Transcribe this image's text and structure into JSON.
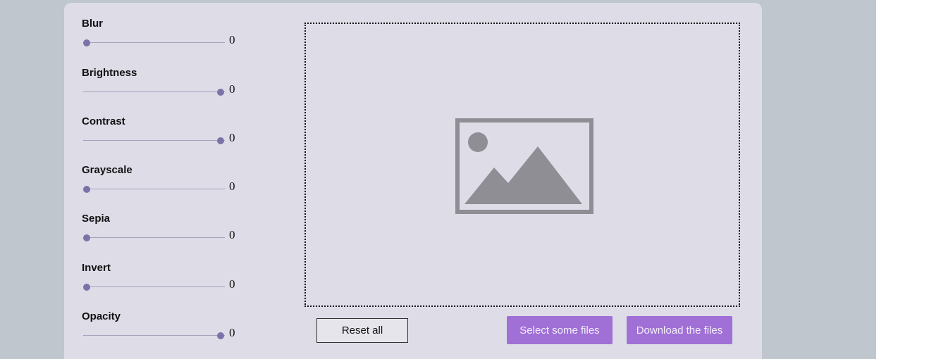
{
  "filters": [
    {
      "label": "Blur",
      "value": "0",
      "thumb": "min"
    },
    {
      "label": "Brightness",
      "value": "0",
      "thumb": "max"
    },
    {
      "label": "Contrast",
      "value": "0",
      "thumb": "max"
    },
    {
      "label": "Grayscale",
      "value": "0",
      "thumb": "min"
    },
    {
      "label": "Sepia",
      "value": "0",
      "thumb": "min"
    },
    {
      "label": "Invert",
      "value": "0",
      "thumb": "min"
    },
    {
      "label": "Opacity",
      "value": "0",
      "thumb": "max"
    }
  ],
  "preview": {
    "icon": "image-placeholder-icon"
  },
  "buttons": {
    "reset": "Reset all",
    "select": "Select some files",
    "download": "Download the files"
  },
  "colors": {
    "accent": "#a070d6",
    "slider_thumb": "#7c72a8",
    "panel": "#dddce7",
    "background": "#c0c6cd",
    "icon_gray": "#8e8e94"
  }
}
